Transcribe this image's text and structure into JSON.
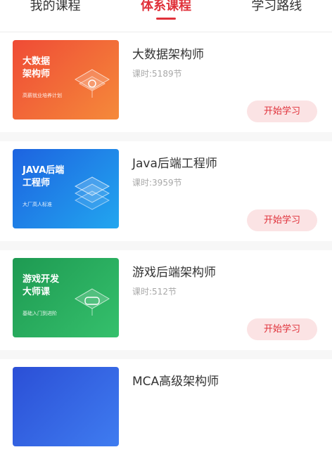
{
  "tabs": [
    {
      "label": "我的课程"
    },
    {
      "label": "体系课程"
    },
    {
      "label": "学习路线"
    }
  ],
  "colors": {
    "accent": "#e0313a",
    "button_bg": "#fbe3e4"
  },
  "courses": [
    {
      "thumb_title": "大数据\n架构师",
      "thumb_sub": "高薪就业培养计划",
      "title": "大数据架构师",
      "meta": "课时:5189节",
      "button": "开始学习"
    },
    {
      "thumb_title": "JAVA后端\n工程师",
      "thumb_sub": "大厂高人标准",
      "title": "Java后端工程师",
      "meta": "课时:3959节",
      "button": "开始学习"
    },
    {
      "thumb_title": "游戏开发\n大师课",
      "thumb_sub": "基础入门到进阶",
      "title": "游戏后端架构师",
      "meta": "课时:512节",
      "button": "开始学习"
    },
    {
      "title": "MCA高级架构师"
    }
  ]
}
